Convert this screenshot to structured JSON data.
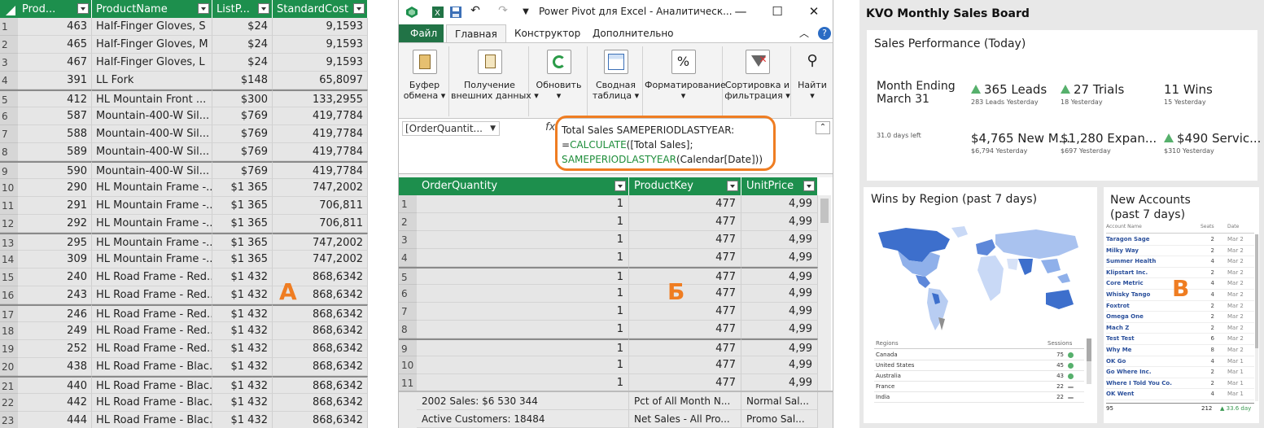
{
  "panel_a": {
    "letter": "А",
    "columns": [
      "Prod...",
      "ProductName",
      "ListP...",
      "StandardCost"
    ],
    "rows": [
      {
        "n": "1",
        "key": "463",
        "name": "Half-Finger Gloves, S",
        "price": "$24",
        "cost": "9,1593"
      },
      {
        "n": "2",
        "key": "465",
        "name": "Half-Finger Gloves, M",
        "price": "$24",
        "cost": "9,1593"
      },
      {
        "n": "3",
        "key": "467",
        "name": "Half-Finger Gloves, L",
        "price": "$24",
        "cost": "9,1593"
      },
      {
        "n": "4",
        "key": "391",
        "name": "LL Fork",
        "price": "$148",
        "cost": "65,8097"
      },
      {
        "n": "5",
        "key": "412",
        "name": "HL Mountain Front ...",
        "price": "$300",
        "cost": "133,2955"
      },
      {
        "n": "6",
        "key": "587",
        "name": "Mountain-400-W Sil...",
        "price": "$769",
        "cost": "419,7784"
      },
      {
        "n": "7",
        "key": "588",
        "name": "Mountain-400-W Sil...",
        "price": "$769",
        "cost": "419,7784"
      },
      {
        "n": "8",
        "key": "589",
        "name": "Mountain-400-W Sil...",
        "price": "$769",
        "cost": "419,7784"
      },
      {
        "n": "9",
        "key": "590",
        "name": "Mountain-400-W Sil...",
        "price": "$769",
        "cost": "419,7784"
      },
      {
        "n": "10",
        "key": "290",
        "name": "HL Mountain Frame -...",
        "price": "$1 365",
        "cost": "747,2002"
      },
      {
        "n": "11",
        "key": "291",
        "name": "HL Mountain Frame -...",
        "price": "$1 365",
        "cost": "706,811"
      },
      {
        "n": "12",
        "key": "292",
        "name": "HL Mountain Frame -...",
        "price": "$1 365",
        "cost": "706,811"
      },
      {
        "n": "13",
        "key": "295",
        "name": "HL Mountain Frame -...",
        "price": "$1 365",
        "cost": "747,2002"
      },
      {
        "n": "14",
        "key": "309",
        "name": "HL Mountain Frame -...",
        "price": "$1 365",
        "cost": "747,2002"
      },
      {
        "n": "15",
        "key": "240",
        "name": "HL Road Frame - Red...",
        "price": "$1 432",
        "cost": "868,6342"
      },
      {
        "n": "16",
        "key": "243",
        "name": "HL Road Frame - Red...",
        "price": "$1 432",
        "cost": "868,6342"
      },
      {
        "n": "17",
        "key": "246",
        "name": "HL Road Frame - Red...",
        "price": "$1 432",
        "cost": "868,6342"
      },
      {
        "n": "18",
        "key": "249",
        "name": "HL Road Frame - Red...",
        "price": "$1 432",
        "cost": "868,6342"
      },
      {
        "n": "19",
        "key": "252",
        "name": "HL Road Frame - Red...",
        "price": "$1 432",
        "cost": "868,6342"
      },
      {
        "n": "20",
        "key": "438",
        "name": "HL Road Frame - Blac...",
        "price": "$1 432",
        "cost": "868,6342"
      },
      {
        "n": "21",
        "key": "440",
        "name": "HL Road Frame - Blac...",
        "price": "$1 432",
        "cost": "868,6342"
      },
      {
        "n": "22",
        "key": "442",
        "name": "HL Road Frame - Blac...",
        "price": "$1 432",
        "cost": "868,6342"
      },
      {
        "n": "23",
        "key": "444",
        "name": "HL Road Frame - Blac...",
        "price": "$1 432",
        "cost": "868,6342"
      }
    ]
  },
  "panel_b": {
    "letter": "Б",
    "window_title": "Power Pivot для Excel - Аналитическ...",
    "tabs": [
      "Файл",
      "Главная",
      "Конструктор",
      "Дополнительно"
    ],
    "ribbon": [
      {
        "label1": "Буфер",
        "label2": "обмена",
        "icon": "clipboard-icon"
      },
      {
        "label1": "Получение",
        "label2": "внешних данных",
        "icon": "get-data-icon"
      },
      {
        "label1": "Обновить",
        "label2": "",
        "icon": "refresh-icon"
      },
      {
        "label1": "Сводная",
        "label2": "таблица",
        "icon": "pivot-table-icon"
      },
      {
        "label1": "Форматирование",
        "label2": "",
        "icon": "percent-icon"
      },
      {
        "label1": "Сортировка и",
        "label2": "фильтрация",
        "icon": "sort-filter-icon"
      },
      {
        "label1": "Найти",
        "label2": "",
        "icon": "binoculars-icon"
      }
    ],
    "name_box": "[OrderQuantit...",
    "fx": "fx",
    "formula": {
      "line1": "Total Sales SAMEPERIODLASTYEAR:",
      "line2_prefix": "=",
      "line2_fn": "CALCULATE",
      "line2_rest": "([Total Sales];",
      "line3_fn": "SAMEPERIODLASTYEAR",
      "line3_rest": "(Calendar[Date]))"
    },
    "columns": [
      "OrderQuantity",
      "ProductKey",
      "UnitPrice"
    ],
    "rows": [
      {
        "n": "1",
        "qty": "1",
        "key": "477",
        "price": "4,99"
      },
      {
        "n": "2",
        "qty": "1",
        "key": "477",
        "price": "4,99"
      },
      {
        "n": "3",
        "qty": "1",
        "key": "477",
        "price": "4,99"
      },
      {
        "n": "4",
        "qty": "1",
        "key": "477",
        "price": "4,99"
      },
      {
        "n": "5",
        "qty": "1",
        "key": "477",
        "price": "4,99"
      },
      {
        "n": "6",
        "qty": "1",
        "key": "477",
        "price": "4,99"
      },
      {
        "n": "7",
        "qty": "1",
        "key": "477",
        "price": "4,99"
      },
      {
        "n": "8",
        "qty": "1",
        "key": "477",
        "price": "4,99"
      },
      {
        "n": "9",
        "qty": "1",
        "key": "477",
        "price": "4,99"
      },
      {
        "n": "10",
        "qty": "1",
        "key": "477",
        "price": "4,99"
      },
      {
        "n": "11",
        "qty": "1",
        "key": "477",
        "price": "4,99"
      }
    ],
    "measures": [
      [
        "2002 Sales: $6 530 344",
        "Pct of All Month N...",
        "Normal Sal..."
      ],
      [
        "Active Customers: 18484",
        "Net Sales - All Pro...",
        "Promo Sal..."
      ]
    ]
  },
  "panel_c": {
    "letter": "В",
    "title": "KVO Monthly Sales Board",
    "perf": {
      "title": "Sales Performance (Today)",
      "month_line1": "Month Ending",
      "month_line2": "March 31",
      "days_left": "31.0 days left",
      "kpis": [
        {
          "value": "365 Leads",
          "sub": "283 Leads Yesterday",
          "up": true
        },
        {
          "value": "27 Trials",
          "sub": "18 Yesterday",
          "up": true
        },
        {
          "value": "11 Wins",
          "sub": "15 Yesterday",
          "up": false
        },
        {
          "value": "$4,765 New M...",
          "sub": "$6,794 Yesterday",
          "up": false
        },
        {
          "value": "$1,280 Expan...",
          "sub": "$697 Yesterday",
          "up": false
        },
        {
          "value": "$490 Servic...",
          "sub": "$310 Yesterday",
          "up": true
        }
      ],
      "up_color": "#56b06c"
    },
    "wins": {
      "title": "Wins by Region (past 7 days)",
      "col_region": "Regions",
      "col_sessions": "Sessions",
      "regions": [
        {
          "name": "Canada",
          "value": "75"
        },
        {
          "name": "United States",
          "value": "45"
        },
        {
          "name": "Australia",
          "value": "43"
        },
        {
          "name": "France",
          "value": "22"
        },
        {
          "name": "India",
          "value": "22"
        }
      ]
    },
    "accounts": {
      "title_line1": "New Accounts",
      "title_line2": "(past 7 days)",
      "col_name": "Account Name",
      "col_seats": "Seats",
      "col_date": "Date",
      "rows": [
        {
          "name": "Taragon Sage",
          "seats": "2",
          "date": "Mar 2"
        },
        {
          "name": "Milky Way",
          "seats": "2",
          "date": "Mar 2"
        },
        {
          "name": "Summer Health",
          "seats": "4",
          "date": "Mar 2"
        },
        {
          "name": "Klipstart Inc.",
          "seats": "2",
          "date": "Mar 2"
        },
        {
          "name": "Core Metric",
          "seats": "4",
          "date": "Mar 2"
        },
        {
          "name": "Whisky Tango",
          "seats": "4",
          "date": "Mar 2"
        },
        {
          "name": "Foxtrot",
          "seats": "2",
          "date": "Mar 2"
        },
        {
          "name": "Omega One",
          "seats": "2",
          "date": "Mar 2"
        },
        {
          "name": "Mach Z",
          "seats": "2",
          "date": "Mar 2"
        },
        {
          "name": "Test Test",
          "seats": "6",
          "date": "Mar 2"
        },
        {
          "name": "Why Me",
          "seats": "8",
          "date": "Mar 2"
        },
        {
          "name": "OK Go",
          "seats": "4",
          "date": "Mar 1"
        },
        {
          "name": "Go Where Inc.",
          "seats": "2",
          "date": "Mar 1"
        },
        {
          "name": "Where I Told You Co.",
          "seats": "2",
          "date": "Mar 1"
        },
        {
          "name": "OK Went",
          "seats": "4",
          "date": "Mar 1"
        }
      ],
      "footer_count": "95",
      "footer_seats": "212",
      "footer_change": "33.6 day"
    }
  },
  "colors": {
    "grid_header": "#1d8f4d",
    "annotation": "#ef7d22",
    "excel_green": "#217346"
  }
}
